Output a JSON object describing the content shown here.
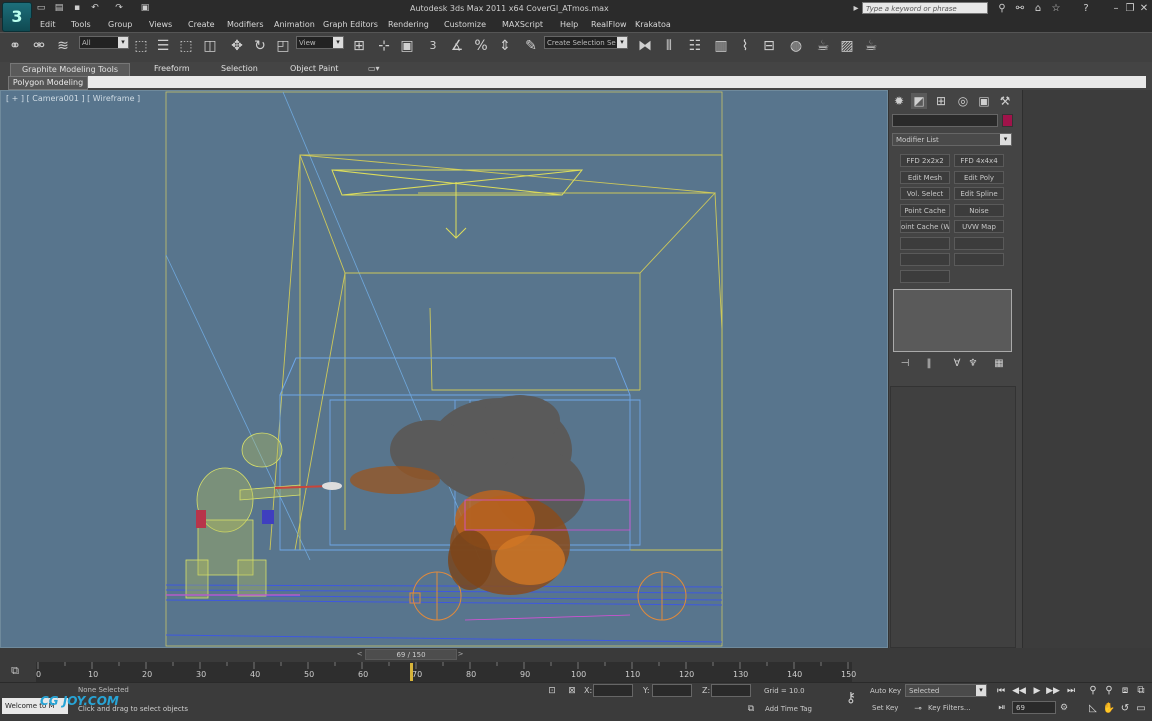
{
  "window": {
    "title": "Autodesk 3ds Max  2011 x64      CoverGI_ATmos.max",
    "app_logo": "3",
    "search_placeholder": "Type a keyword or phrase"
  },
  "menu": [
    "Edit",
    "Tools",
    "Group",
    "Views",
    "Create",
    "Modifiers",
    "Animation",
    "Graph Editors",
    "Rendering",
    "Customize",
    "MAXScript",
    "Help",
    "RealFlow",
    "Krakatoa"
  ],
  "toolbar": {
    "selection_filter": "All",
    "reference_coord": "View",
    "named_selection_placeholder": "Create Selection Se",
    "snap_label": "3"
  },
  "ribbon": {
    "tabs": [
      "Graphite Modeling Tools",
      "Freeform",
      "Selection",
      "Object Paint"
    ],
    "panel_label": "Polygon Modeling"
  },
  "viewport": {
    "label": "[ + ] [ Camera001 ] [ Wireframe ]"
  },
  "command_panel": {
    "modifier_list_label": "Modifier List",
    "modifier_buttons": [
      "FFD 2x2x2",
      "FFD 4x4x4",
      "Edit Mesh",
      "Edit Poly",
      "Vol. Select",
      "Edit Spline",
      "Point Cache",
      "Noise",
      "oint Cache (WS",
      "UVW Map",
      "",
      "",
      "",
      ""
    ],
    "colors": {
      "object_color": "#a0134a"
    }
  },
  "time_slider": {
    "label": "69 / 150",
    "prev_arrow": "<",
    "next_arrow": ">"
  },
  "trackbar": {
    "ticks": [
      "0",
      "10",
      "20",
      "30",
      "40",
      "50",
      "60",
      "70",
      "80",
      "90",
      "100",
      "110",
      "120",
      "130",
      "140",
      "150"
    ],
    "current_frame": 69
  },
  "status": {
    "selection_status": "None Selected",
    "prompt": "Click and drag to select objects",
    "listener_text": "Welcome to M",
    "x_label": "X:",
    "y_label": "Y:",
    "z_label": "Z:",
    "grid": "Grid = 10.0",
    "add_time_tag": "Add Time Tag",
    "auto_key": "Auto Key",
    "set_key": "Set Key",
    "key_mode": "Selected",
    "key_filters": "Key Filters...",
    "frame": "69",
    "watermark": "CG JOY.COM"
  }
}
